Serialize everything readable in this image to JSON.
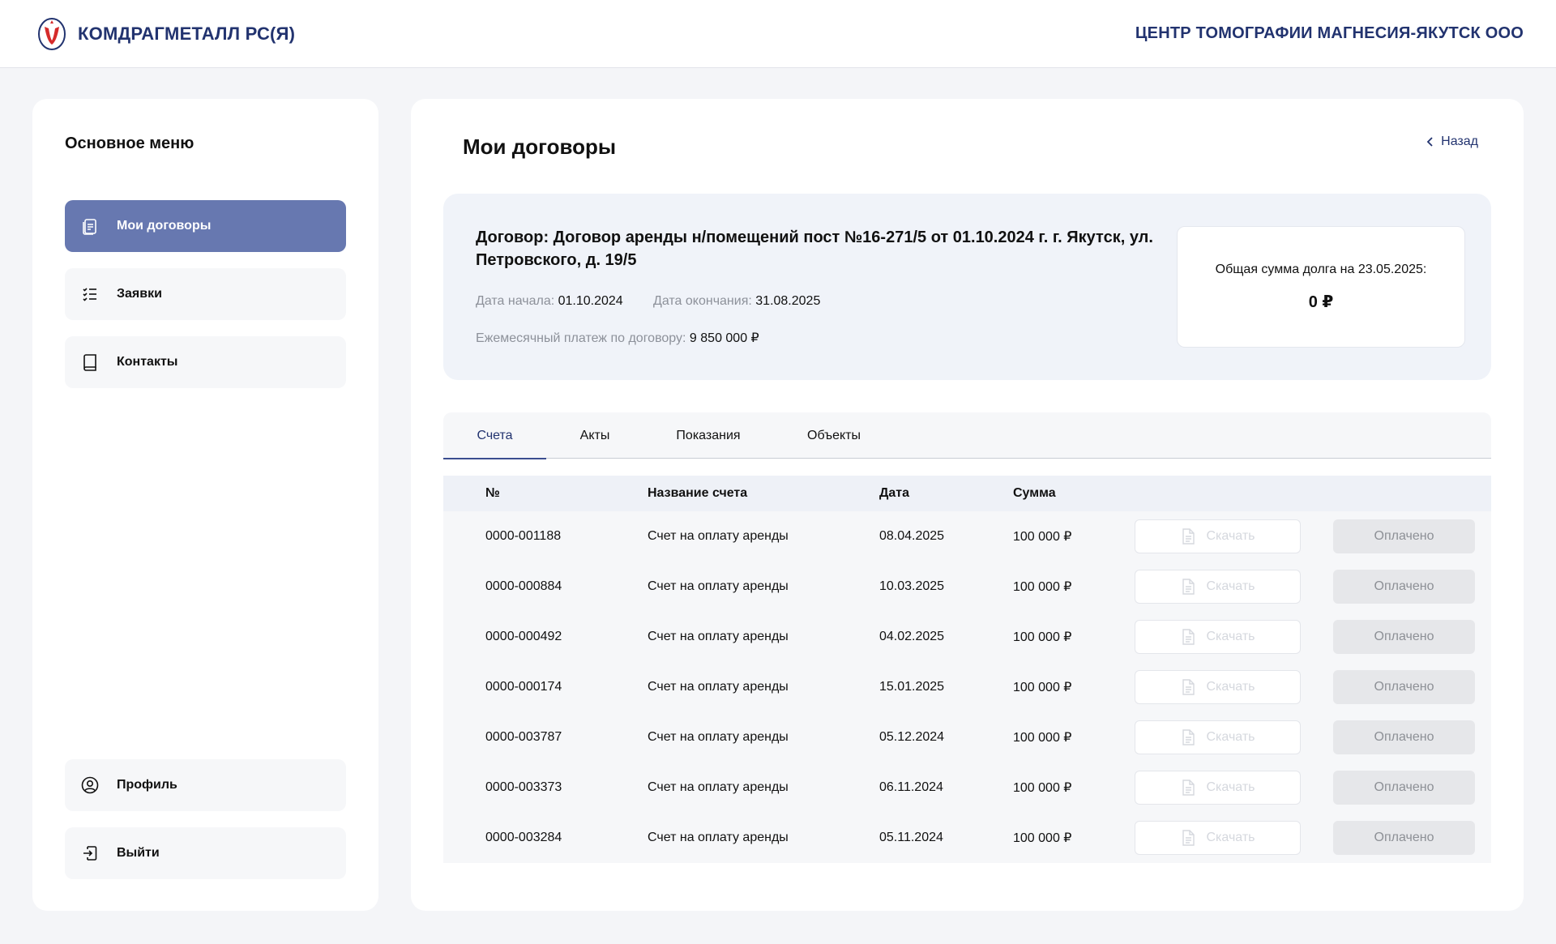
{
  "header": {
    "brand": "КОМДРАГМЕТАЛЛ РС(Я)",
    "organization": "ЦЕНТР ТОМОГРАФИИ МАГНЕСИЯ-ЯКУТСК ООО"
  },
  "sidebar": {
    "title": "Основное меню",
    "items": [
      {
        "label": "Мои договоры",
        "icon": "document-icon",
        "active": true
      },
      {
        "label": "Заявки",
        "icon": "list-icon"
      },
      {
        "label": "Контакты",
        "icon": "book-icon"
      }
    ],
    "bottom_items": [
      {
        "label": "Профиль",
        "icon": "user-circle-icon"
      },
      {
        "label": "Выйти",
        "icon": "logout-icon"
      }
    ]
  },
  "main": {
    "title": "Мои договоры",
    "back_label": "Назад",
    "contract": {
      "title": "Договор: Договор аренды н/помещений пост №16-271/5 от 01.10.2024 г. г. Якутск, ул. Петровского, д. 19/5",
      "start_label": "Дата начала:",
      "start_value": "01.10.2024",
      "end_label": "Дата окончания:",
      "end_value": "31.08.2025",
      "payment_label": "Ежемесячный платеж по договору:",
      "payment_value": "9 850 000 ₽",
      "debt_label": "Общая сумма долга на 23.05.2025:",
      "debt_value": "0 ₽"
    },
    "tabs": [
      "Счета",
      "Акты",
      "Показания",
      "Объекты"
    ],
    "active_tab": "Счета",
    "table": {
      "headers": {
        "num": "№",
        "name": "Название счета",
        "date": "Дата",
        "sum": "Сумма"
      },
      "download_label": "Скачать",
      "rows": [
        {
          "num": "0000-001188",
          "name": "Счет на оплату аренды",
          "date": "08.04.2025",
          "sum": "100 000 ₽",
          "status": "Оплачено"
        },
        {
          "num": "0000-000884",
          "name": "Счет на оплату аренды",
          "date": "10.03.2025",
          "sum": "100 000 ₽",
          "status": "Оплачено"
        },
        {
          "num": "0000-000492",
          "name": "Счет на оплату аренды",
          "date": "04.02.2025",
          "sum": "100 000 ₽",
          "status": "Оплачено"
        },
        {
          "num": "0000-000174",
          "name": "Счет на оплату аренды",
          "date": "15.01.2025",
          "sum": "100 000 ₽",
          "status": "Оплачено"
        },
        {
          "num": "0000-003787",
          "name": "Счет на оплату аренды",
          "date": "05.12.2024",
          "sum": "100 000 ₽",
          "status": "Оплачено"
        },
        {
          "num": "0000-003373",
          "name": "Счет на оплату аренды",
          "date": "06.11.2024",
          "sum": "100 000 ₽",
          "status": "Оплачено"
        },
        {
          "num": "0000-003284",
          "name": "Счет на оплату аренды",
          "date": "05.11.2024",
          "sum": "100 000 ₽",
          "status": "Оплачено"
        }
      ]
    }
  },
  "colors": {
    "brand": "#22336f",
    "nav_active": "#6778b0",
    "card_bg": "#f0f3f9"
  }
}
